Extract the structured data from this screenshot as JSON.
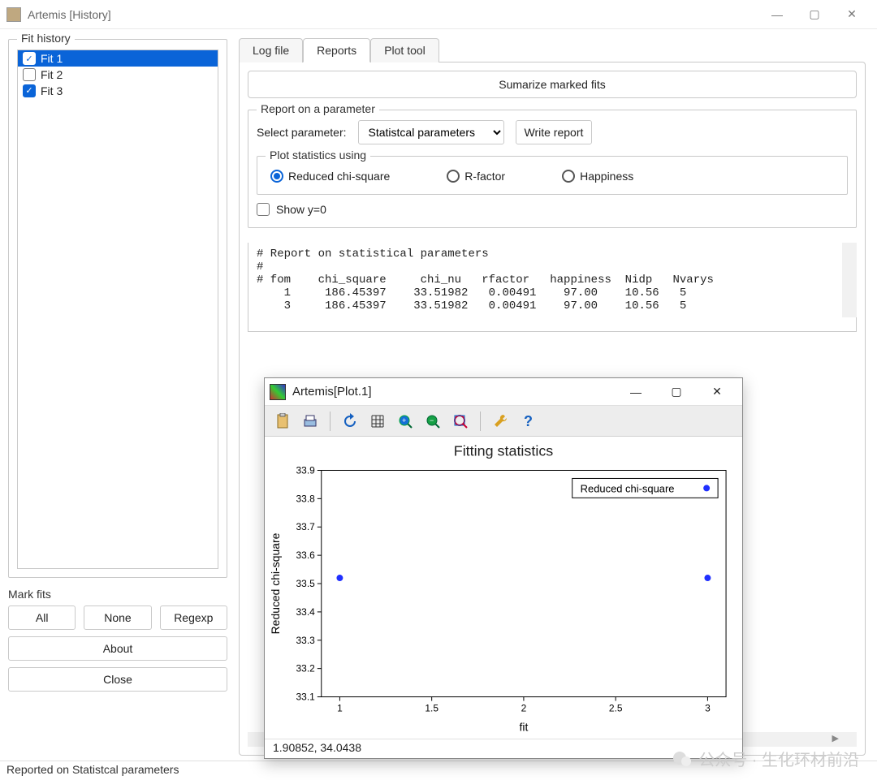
{
  "window": {
    "title": "Artemis [History]",
    "minimize_icon": "—",
    "maximize_icon": "▢",
    "close_icon": "✕"
  },
  "sidebar": {
    "fit_history_legend": "Fit history",
    "items": [
      {
        "label": "Fit 1",
        "checked": true,
        "selected": true
      },
      {
        "label": "Fit 2",
        "checked": false,
        "selected": false
      },
      {
        "label": "Fit 3",
        "checked": true,
        "selected": false
      }
    ],
    "mark_fits_legend": "Mark fits",
    "all_label": "All",
    "none_label": "None",
    "regexp_label": "Regexp",
    "about_label": "About",
    "close_label": "Close"
  },
  "tabs": {
    "log_file": "Log file",
    "reports": "Reports",
    "plot_tool": "Plot tool"
  },
  "reports": {
    "summarize_label": "Sumarize marked fits",
    "group_legend": "Report on a parameter",
    "select_label": "Select parameter:",
    "select_value": "Statistcal parameters",
    "write_report_label": "Write report",
    "plot_group_legend": "Plot statistics using",
    "radio_reduced": "Reduced chi-square",
    "radio_rfactor": "R-factor",
    "radio_happiness": "Happiness",
    "show_y0": "Show y=0",
    "text_header1": "# Report on statistical parameters",
    "text_header2": "#",
    "text_columns": "# fom    chi_square     chi_nu   rfactor   happiness  Nidp   Nvarys",
    "rows": [
      "    1     186.45397    33.51982   0.00491    97.00    10.56   5",
      "    3     186.45397    33.51982   0.00491    97.00    10.56   5"
    ]
  },
  "plot_window": {
    "title": "Artemis[Plot.1]",
    "status": "1.90852,  34.0438",
    "toolbar_icons": [
      "clipboard-icon",
      "print-icon",
      "refresh-icon",
      "grid-icon",
      "zoom-in-icon",
      "zoom-out-icon",
      "zoom-region-icon",
      "wrench-icon",
      "help-icon"
    ]
  },
  "chart_data": {
    "type": "scatter",
    "title": "Fitting statistics",
    "xlabel": "fit",
    "ylabel": "Reduced chi-square",
    "x_ticks": [
      1,
      1.5,
      2,
      2.5,
      3
    ],
    "y_ticks": [
      33.1,
      33.2,
      33.3,
      33.4,
      33.5,
      33.6,
      33.7,
      33.8,
      33.9
    ],
    "xlim": [
      0.9,
      3.1
    ],
    "ylim": [
      33.1,
      33.9
    ],
    "legend": [
      "Reduced chi-square"
    ],
    "legend_position": "top-right",
    "series": [
      {
        "name": "Reduced chi-square",
        "x": [
          1,
          3
        ],
        "y": [
          33.52,
          33.52
        ],
        "color": "#2030ff"
      }
    ]
  },
  "status": "Reported on Statistcal parameters",
  "watermark": "公众号 · 生化环材前沿"
}
